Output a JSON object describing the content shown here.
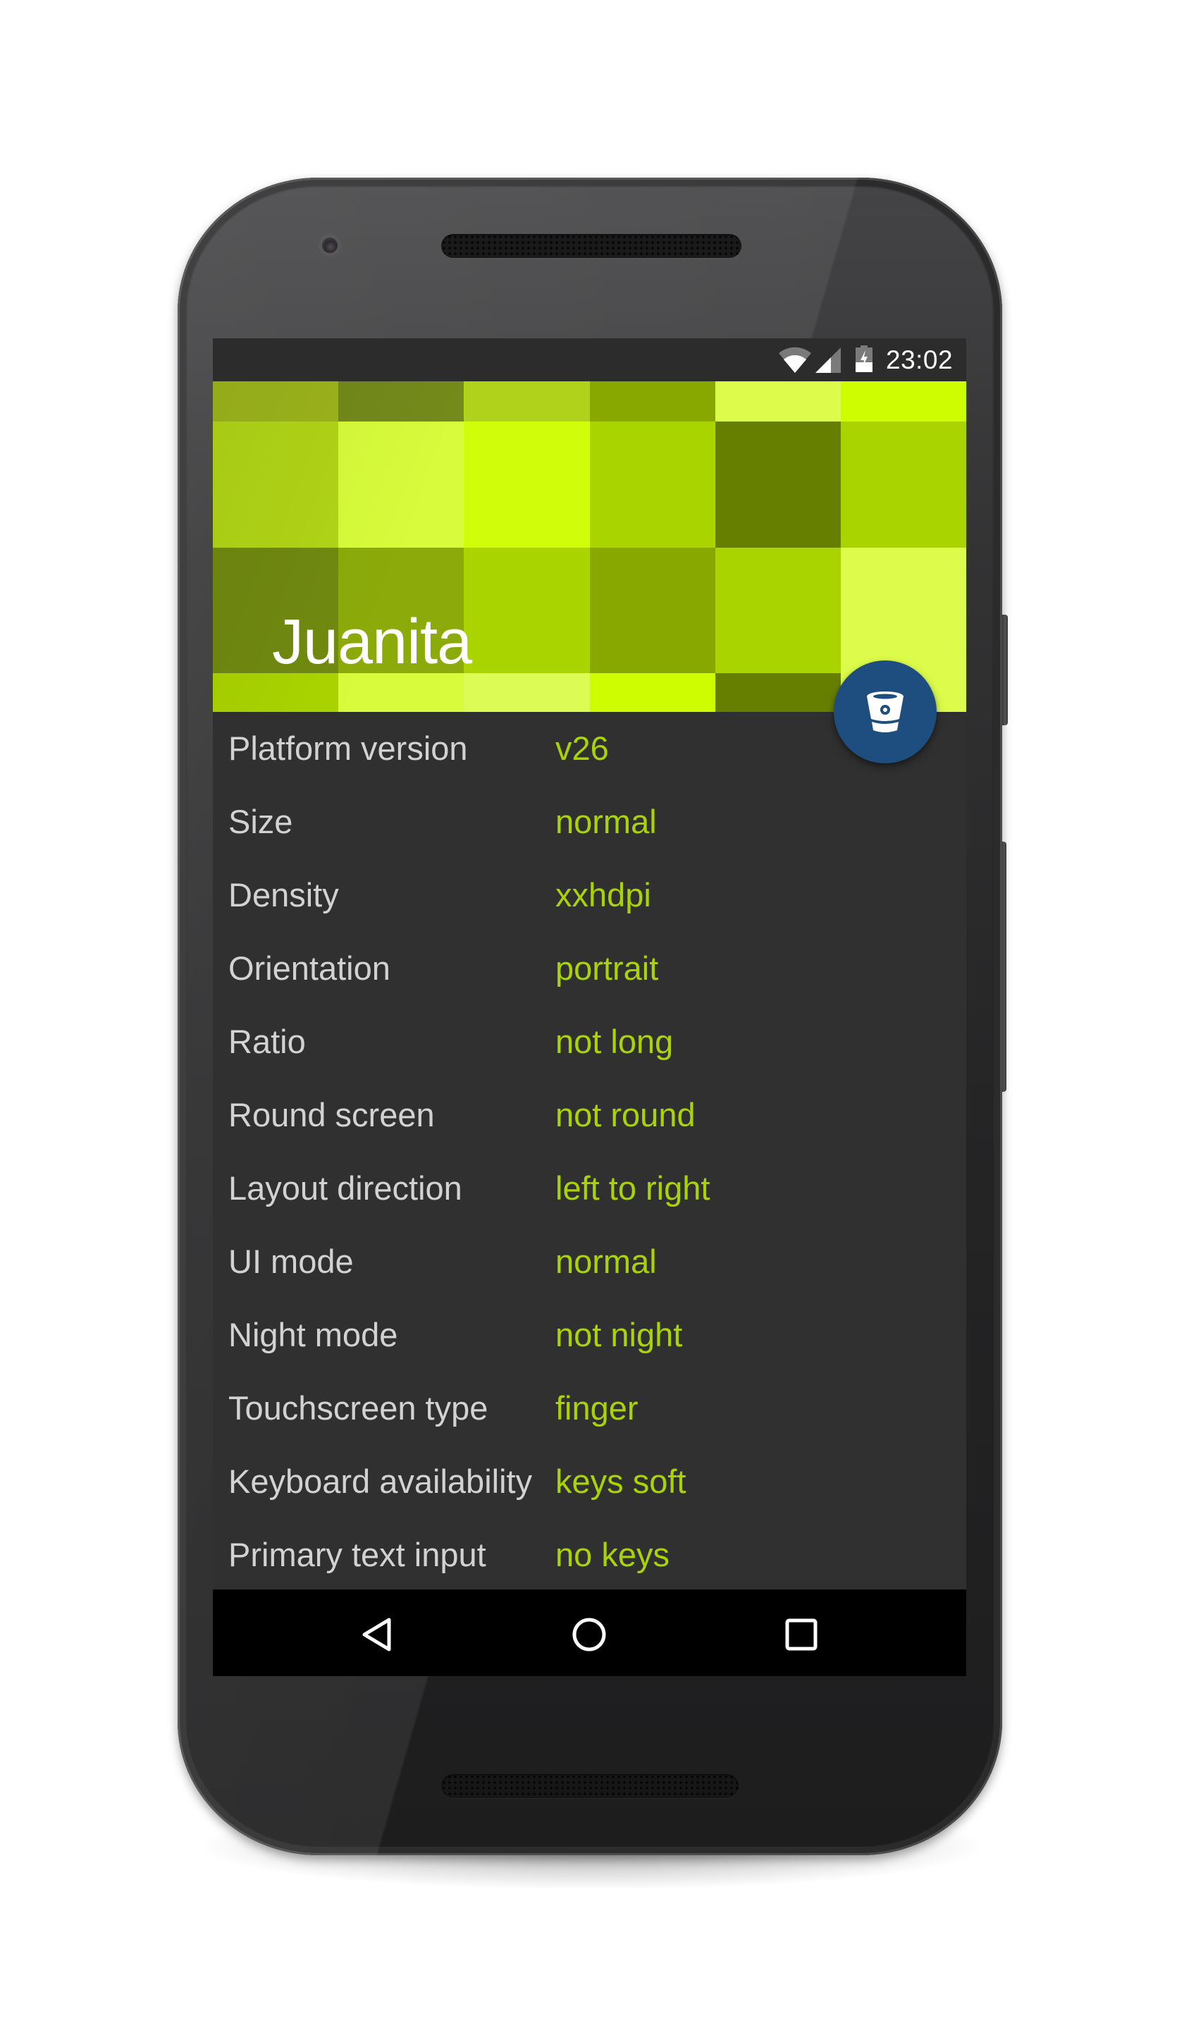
{
  "status_bar": {
    "time": "23:02",
    "icons": [
      "wifi-icon",
      "cell-signal-icon",
      "battery-charging-icon"
    ]
  },
  "header": {
    "title": "Juanita",
    "tile_grid": [
      [
        "#9db51c",
        "#748a1a",
        "#b0d21a",
        "#88a800",
        "#dcfb4a",
        "#cdfd00"
      ],
      [
        "#b2d617",
        "#d8fc3b",
        "#cffd0a",
        "#aad400",
        "#677f00",
        "#aad400"
      ],
      [
        "#718a10",
        "#8cab0a",
        "#aad400",
        "#88a800",
        "#aad400",
        "#dcfb4a"
      ],
      [
        "#aad400",
        "#d8fc3b",
        "#dcfc55",
        "#cdfd00",
        "#677f00",
        "#dcfb4a"
      ]
    ]
  },
  "fab": {
    "icon": "bitbucket-icon",
    "color": "#1d4e7f"
  },
  "info": {
    "rows": [
      {
        "label": "Platform version",
        "value": "v26"
      },
      {
        "label": "Size",
        "value": "normal"
      },
      {
        "label": "Density",
        "value": "xxhdpi"
      },
      {
        "label": "Orientation",
        "value": "portrait"
      },
      {
        "label": "Ratio",
        "value": "not long"
      },
      {
        "label": "Round screen",
        "value": "not round"
      },
      {
        "label": "Layout direction",
        "value": "left to right"
      },
      {
        "label": "UI mode",
        "value": "normal"
      },
      {
        "label": "Night mode",
        "value": "not night"
      },
      {
        "label": "Touchscreen type",
        "value": "finger"
      },
      {
        "label": "Keyboard availability",
        "value": "keys soft"
      },
      {
        "label": "Primary text input",
        "value": "no keys"
      }
    ]
  },
  "nav_bar": {
    "buttons": [
      "back",
      "home",
      "recents"
    ]
  },
  "colors": {
    "accent": "#aad400",
    "label": "#d2d2d2",
    "background": "#303030",
    "fab": "#1d4e7f"
  }
}
